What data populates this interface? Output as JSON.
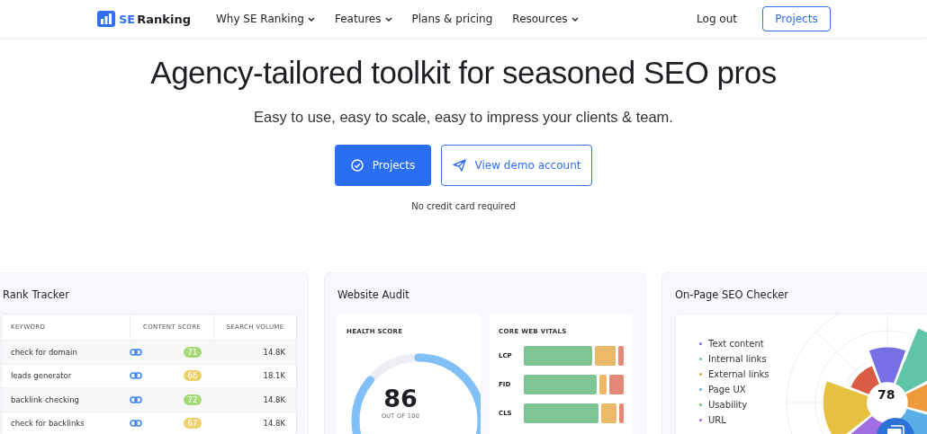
{
  "nav": {
    "logo_mark": "SE",
    "logo_text": "Ranking",
    "items": [
      {
        "label": "Why SE Ranking",
        "dropdown": true
      },
      {
        "label": "Features",
        "dropdown": true
      },
      {
        "label": "Plans & pricing",
        "dropdown": false
      },
      {
        "label": "Resources",
        "dropdown": true
      }
    ],
    "login": "Log out",
    "cta": "Projects"
  },
  "hero": {
    "title": "Agency-tailored toolkit for seasoned SEO pros",
    "subtitle": "Easy to use, easy to scale, easy to impress your clients & team.",
    "primary": "Projects",
    "secondary": "View demo account",
    "note": "No credit card required"
  },
  "rank_tracker": {
    "title": "Rank Tracker",
    "columns": [
      "KEYWORD",
      "CONTENT SCORE",
      "SEARCH VOLUME"
    ],
    "rows": [
      {
        "keyword": "check for domain",
        "score": "71",
        "color": "#a3d977",
        "volume": "14.8K"
      },
      {
        "keyword": "leads generator",
        "score": "66",
        "color": "#ecd06b",
        "volume": "18.1K"
      },
      {
        "keyword": "backlink checking",
        "score": "72",
        "color": "#a3d977",
        "volume": "14.8K"
      },
      {
        "keyword": "check for backlinks",
        "score": "67",
        "color": "#ecd06b",
        "volume": "14.8K"
      }
    ]
  },
  "audit": {
    "title": "Website Audit",
    "health_label": "HEALTH SCORE",
    "score": "86",
    "score_note": "OUT OF 100",
    "vitals_label": "CORE WEB VITALS",
    "vitals": [
      {
        "name": "LCP"
      },
      {
        "name": "FID"
      },
      {
        "name": "CLS"
      }
    ]
  },
  "checker": {
    "title": "On-Page SEO Checker",
    "score": "78",
    "legend": [
      {
        "label": "Text content",
        "color": "#7b6ee6"
      },
      {
        "label": "Internal links",
        "color": "#5fc4a8"
      },
      {
        "label": "External links",
        "color": "#ee9a3a"
      },
      {
        "label": "Page UX",
        "color": "#58aee6"
      },
      {
        "label": "Usability",
        "color": "#6cc46c"
      },
      {
        "label": "URL",
        "color": "#a06ee0"
      }
    ]
  }
}
